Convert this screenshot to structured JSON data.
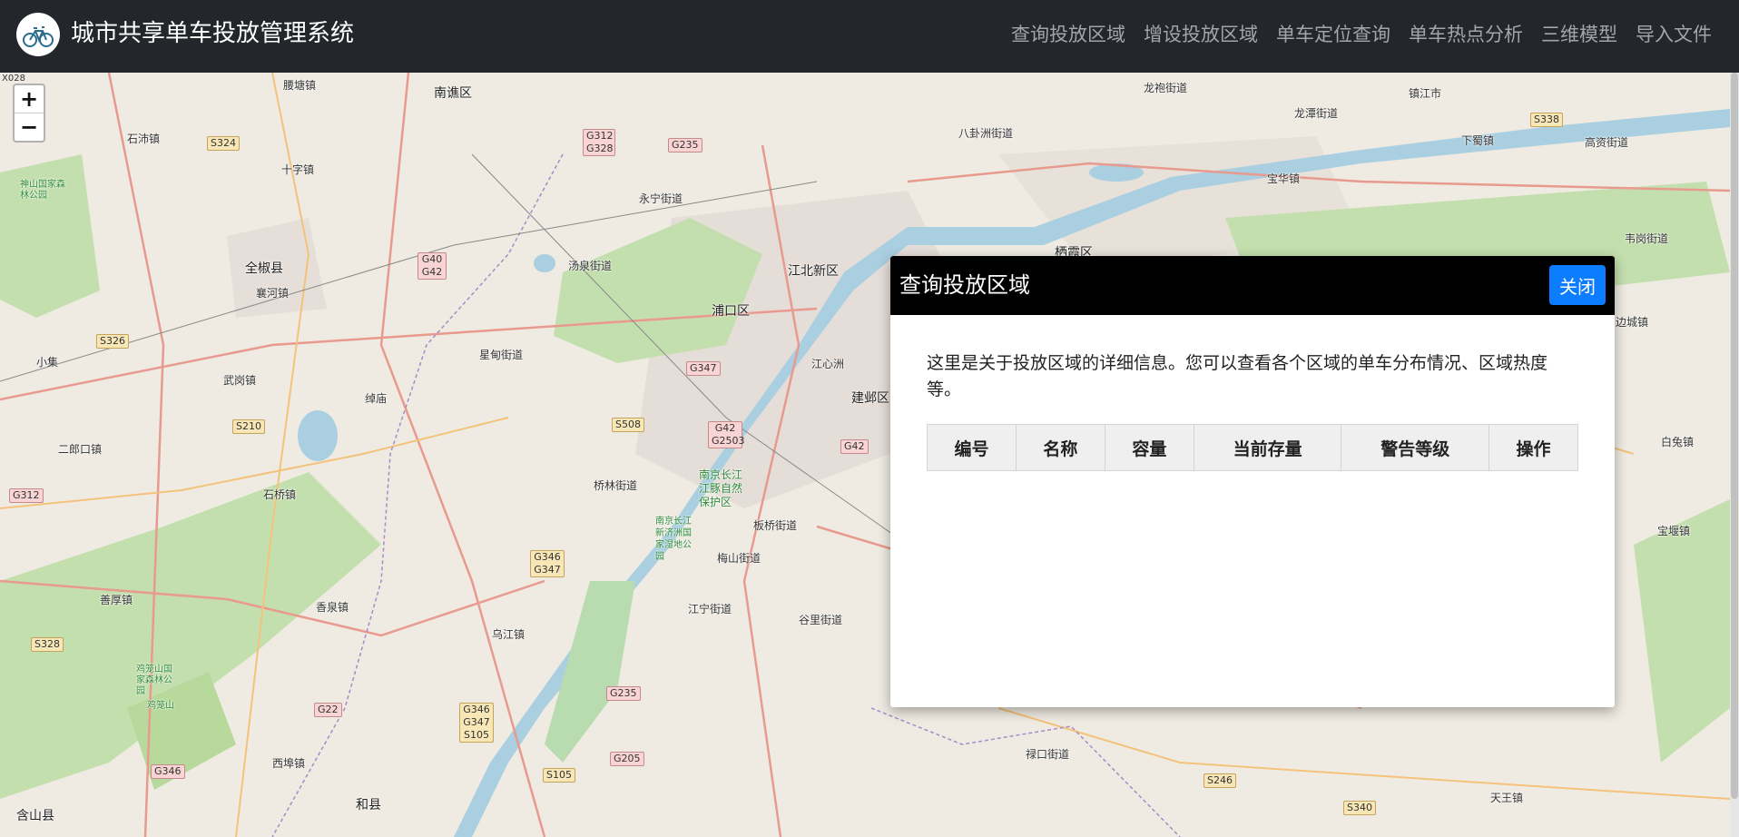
{
  "navbar": {
    "title": "城市共享单车投放管理系统",
    "logo_icon": "bicycle-logo-icon",
    "items": [
      {
        "label": "查询投放区域"
      },
      {
        "label": "增设投放区域"
      },
      {
        "label": "单车定位查询"
      },
      {
        "label": "单车热点分析"
      },
      {
        "label": "三维模型"
      },
      {
        "label": "导入文件"
      }
    ]
  },
  "map": {
    "zoom_in_label": "+",
    "zoom_out_label": "−",
    "corner_label": "X028",
    "places": {
      "p1": "腰塘镇",
      "p2": "南谯区",
      "p3": "石沛镇",
      "p4": "十字镇",
      "p5": "神山国家森林公园",
      "p6": "全椒县",
      "p7": "襄河镇",
      "p8": "小集",
      "p9": "武岗镇",
      "p10": "二郎口镇",
      "p11": "石桥镇",
      "p12": "善厚镇",
      "p13": "香泉镇",
      "p14": "乌江镇",
      "p15": "西埠镇",
      "p16": "和县",
      "p17": "含山县",
      "p18": "鸡笼山国家森林公园",
      "p19": "鸡笼山",
      "p20": "永宁街道",
      "p21": "汤泉街道",
      "p22": "星甸街道",
      "p23": "绰庙",
      "p24": "江北新区",
      "p25": "浦口区",
      "p26": "桥林街道",
      "p27": "南京长江江豚自然保护区",
      "p28": "南京长江新济洲国家湿地公园",
      "p29": "江宁街道",
      "p30": "板桥街道",
      "p31": "梅山街道",
      "p32": "谷里街道",
      "p33": "建邺区",
      "p34": "江心洲",
      "p35": "八卦洲街道",
      "p36": "龙袍街道",
      "p37": "龙潭街道",
      "p38": "宝华镇",
      "p39": "下蜀镇",
      "p40": "高资街道",
      "p41": "韦岗街道",
      "p42": "栖霞区",
      "p43": "禄口街道",
      "p44": "天王镇",
      "p45": "白兔镇",
      "p46": "宝堰镇",
      "p47": "边城镇",
      "p48": "镇江市"
    },
    "shields": {
      "s1": "S324",
      "s2": "S326",
      "s3": "S210",
      "s4": "G312",
      "s5": "S328",
      "s6": "G346",
      "s7": "G312 G328",
      "s8": "G235",
      "s9": "G40 G42",
      "s10": "G347",
      "s11": "S508",
      "s12": "G42 G2503",
      "s13": "G346 G347",
      "s14": "G22",
      "s15": "G346 G347 S105",
      "s16": "G235",
      "s17": "S105",
      "s18": "G205",
      "s19": "G42",
      "s20": "S338",
      "s21": "S246",
      "s22": "S340"
    }
  },
  "modal": {
    "title": "查询投放区域",
    "close_label": "关闭",
    "description": "这里是关于投放区域的详细信息。您可以查看各个区域的单车分布情况、区域热度等。",
    "table": {
      "columns": [
        "编号",
        "名称",
        "容量",
        "当前存量",
        "警告等级",
        "操作"
      ],
      "rows": []
    }
  },
  "colors": {
    "navbar_bg": "#23272b",
    "modal_header_bg": "#000000",
    "close_button_bg": "#0d7dff",
    "river": "#a9cfe0",
    "forest": "#c4dfae"
  }
}
